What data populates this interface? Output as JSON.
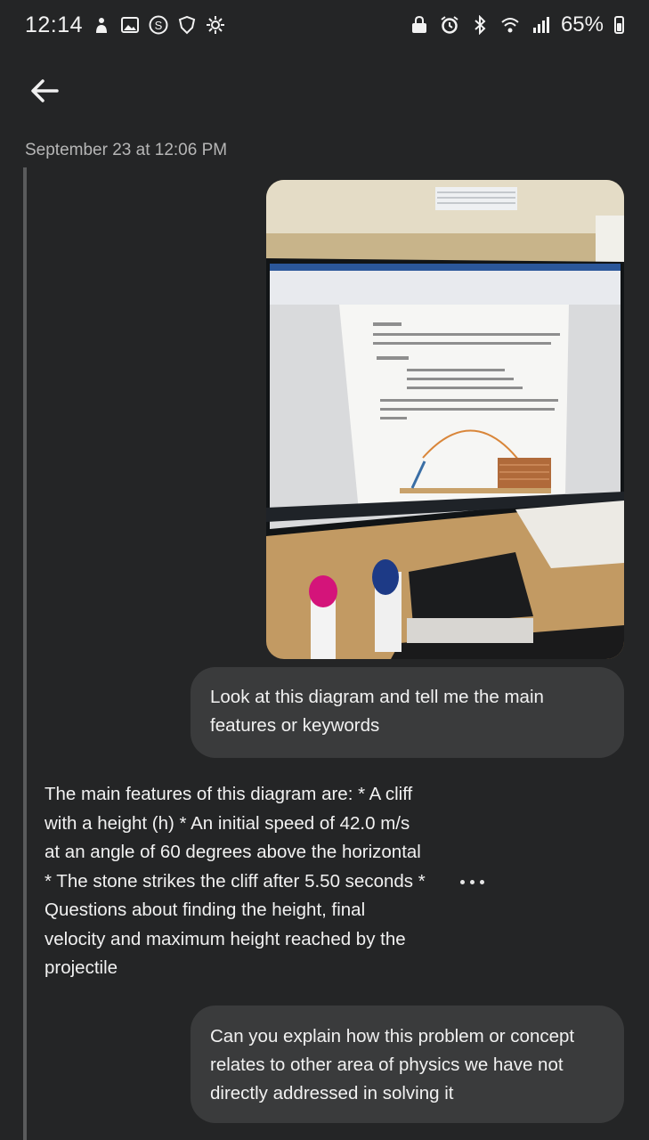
{
  "status_bar": {
    "time": "12:14",
    "battery": "65%",
    "battery_level": 0.65,
    "left_icons": [
      "hand-icon",
      "gallery-icon",
      "s-badge-icon",
      "shield-icon",
      "settings-icon"
    ],
    "right_icons": [
      "lock-icon",
      "alarm-icon",
      "bluetooth-icon",
      "wifi-icon",
      "signal-icon",
      "battery-icon"
    ]
  },
  "header": {
    "back_icon": "arrow-left-icon"
  },
  "conversation": {
    "timestamp": "September 23 at 12:06 PM",
    "photo": {
      "description_icon": "photo-of-monitor"
    },
    "messages": [
      {
        "role": "user",
        "text": "Look at this diagram and tell me the main features or keywords"
      },
      {
        "role": "assistant",
        "text": "The main features of this diagram are: * A cliff with a height (h) * An initial speed of 42.0 m/s at an angle of 60 degrees above the horizontal * The stone strikes the cliff after 5.50 seconds * Questions about finding the height, final velocity and maximum height reached by the projectile"
      },
      {
        "role": "user",
        "text": "Can you explain how this problem or concept relates to other area of physics we have not directly addressed in solving it"
      }
    ],
    "more_icon": "more-dots-icon"
  },
  "colors": {
    "background": "#242526",
    "bubble": "#3a3b3c",
    "text": "#f1f1f1",
    "muted": "#b6b6b6"
  }
}
